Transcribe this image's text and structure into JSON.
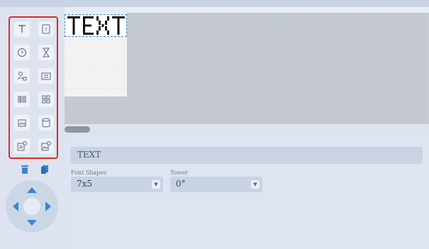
{
  "toolbar": {
    "tools": [
      {
        "name": "text-tool",
        "icon": "text-icon"
      },
      {
        "name": "variable-tool",
        "icon": "question-box-icon"
      },
      {
        "name": "clock-tool",
        "icon": "clock-icon"
      },
      {
        "name": "counter-tool",
        "icon": "hourglass-icon"
      },
      {
        "name": "shift-tool",
        "icon": "person-badge-icon"
      },
      {
        "name": "date-tool",
        "icon": "calendar-grid-icon"
      },
      {
        "name": "barcode-tool",
        "icon": "barcode-icon"
      },
      {
        "name": "qrcode-tool",
        "icon": "qrcode-icon"
      },
      {
        "name": "image-tool",
        "icon": "image-icon"
      },
      {
        "name": "database-tool",
        "icon": "cylinder-icon"
      },
      {
        "name": "dynamic-text-tool",
        "icon": "doc-badge-icon"
      },
      {
        "name": "dynamic-image-tool",
        "icon": "image-badge-icon"
      }
    ],
    "actions": {
      "delete_icon": "trash-icon",
      "copy_icon": "copy-icon"
    },
    "accent_color": "#e0292b"
  },
  "canvas": {
    "object_text": "TEXT"
  },
  "properties": {
    "text_value": "TEXT",
    "font_shapes_label": "Font Shapes",
    "font_shapes_value": "7x5",
    "tower_label": "Tower",
    "tower_value": "0°"
  },
  "colors": {
    "accent": "#3b84d6",
    "selection": "#3a8fd6"
  }
}
